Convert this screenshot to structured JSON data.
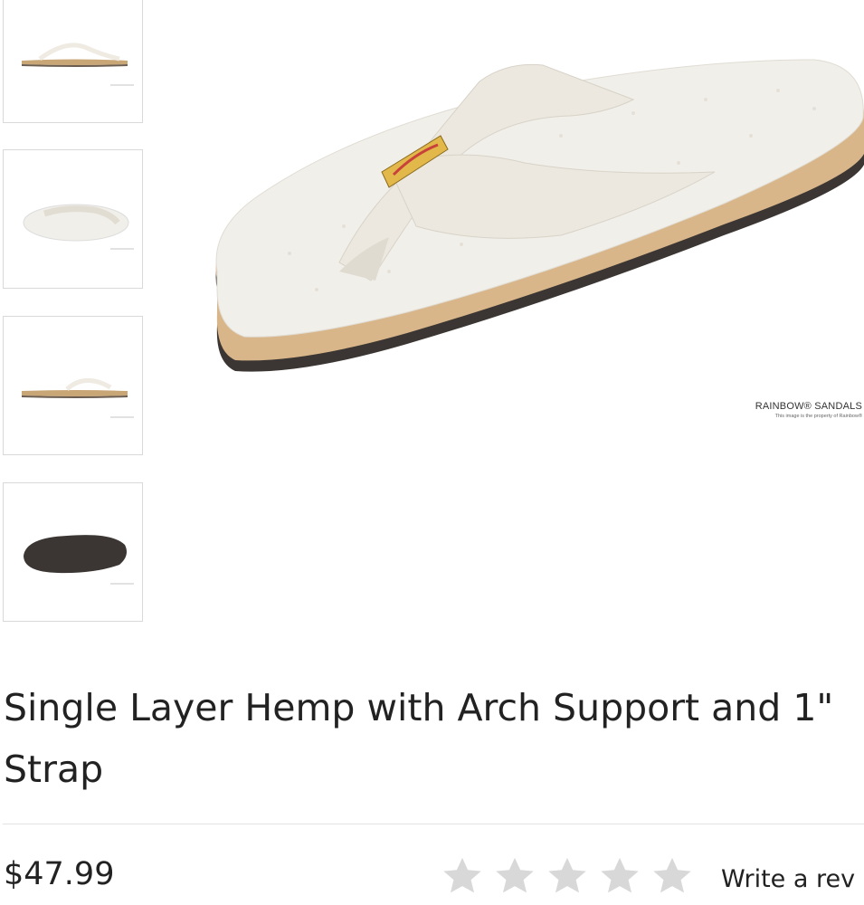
{
  "product": {
    "title": "Single Layer Hemp with Arch Support and 1\" Strap",
    "price": "$47.99",
    "rating": 0,
    "rating_max": 5,
    "write_review_label": "Write a rev"
  },
  "gallery": {
    "thumbnails": [
      {
        "view": "side"
      },
      {
        "view": "top"
      },
      {
        "view": "side"
      },
      {
        "view": "sole"
      }
    ],
    "watermark_brand": "RAINBOW® SANDALS",
    "watermark_note": "This image is the property of Rainbow®"
  },
  "colors": {
    "hemp": "#f1efea",
    "tan": "#d9b689",
    "sole": "#3b3633",
    "star_empty": "#d8d8d8"
  }
}
